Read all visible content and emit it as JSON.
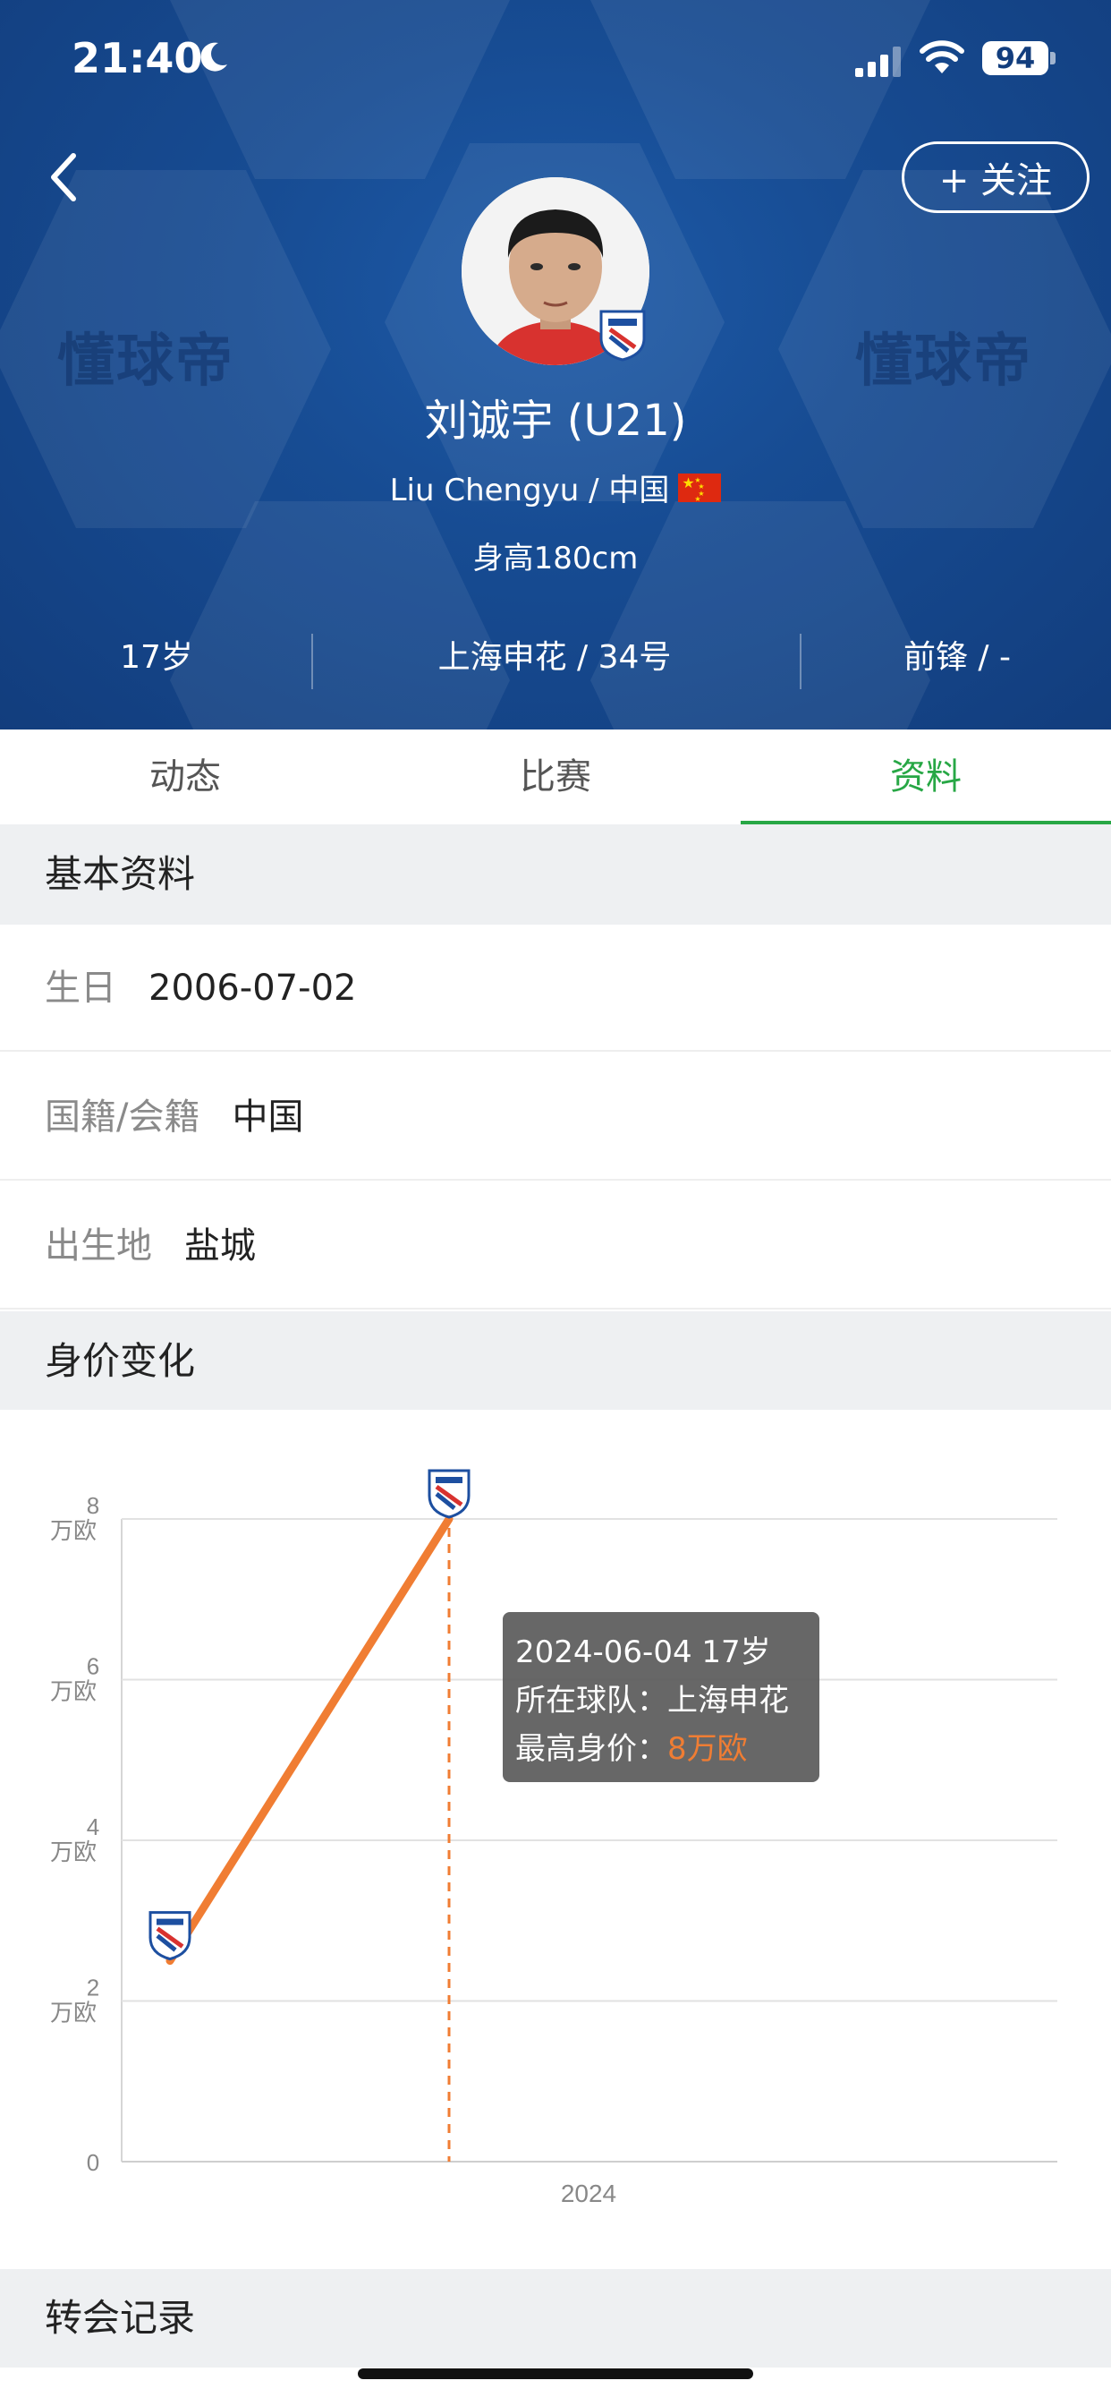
{
  "status_bar": {
    "time": "21:40",
    "battery": "94"
  },
  "header": {
    "follow_label": "+ 关注",
    "watermark": "懂球帝",
    "player_name": "刘诚宇 (U21)",
    "player_sub": "Liu Chengyu / 中国",
    "height": "身高180cm",
    "age": "17岁",
    "club_number": "上海申花 / 34号",
    "position": "前锋 / -"
  },
  "tabs": [
    {
      "label": "动态"
    },
    {
      "label": "比赛"
    },
    {
      "label": "资料",
      "active": true
    }
  ],
  "basic_info": {
    "title": "基本资料",
    "rows": [
      {
        "label": "生日",
        "value": "2006-07-02"
      },
      {
        "label": "国籍/会籍",
        "value": "中国"
      },
      {
        "label": "出生地",
        "value": "盐城"
      }
    ]
  },
  "value_section": {
    "title": "身价变化"
  },
  "chart_data": {
    "type": "line",
    "x_tick_labels": [
      "2024"
    ],
    "y_ticks": [
      {
        "value": 0,
        "label": "0",
        "unit": ""
      },
      {
        "value": 2,
        "label": "2",
        "unit": "万欧"
      },
      {
        "value": 4,
        "label": "4",
        "unit": "万欧"
      },
      {
        "value": 6,
        "label": "6",
        "unit": "万欧"
      },
      {
        "value": 8,
        "label": "8",
        "unit": "万欧"
      }
    ],
    "ylim": [
      0,
      8
    ],
    "points": [
      {
        "x": "2023",
        "y": 2.5,
        "marker": "club-crest"
      },
      {
        "x": "2024-06-04",
        "y": 8,
        "marker": "club-crest"
      }
    ],
    "line_color": "#f07d33",
    "grid": true,
    "tooltip": {
      "line1": "2024-06-04 17岁",
      "line2_label": "所在球队：",
      "line2_value": "上海申花",
      "line3_label": "最高身价：",
      "line3_value": "8万欧"
    }
  },
  "transfer_section": {
    "title": "转会记录"
  }
}
